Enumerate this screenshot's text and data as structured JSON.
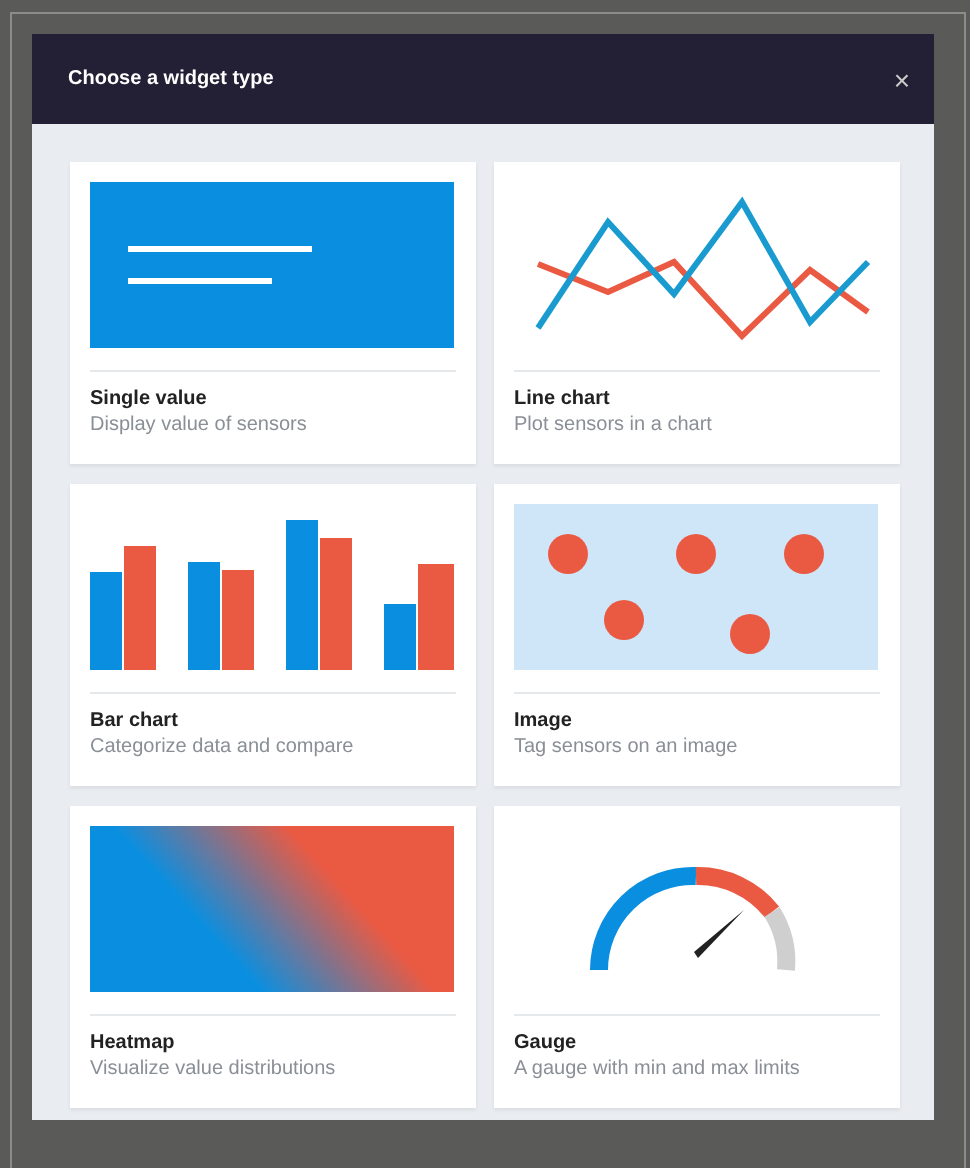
{
  "dialog": {
    "title": "Choose a widget type",
    "close": "×"
  },
  "widgets": [
    {
      "kind": "single_value",
      "title": "Single value",
      "description": "Display value of sensors"
    },
    {
      "kind": "line",
      "title": "Line chart",
      "description": "Plot sensors in a chart"
    },
    {
      "kind": "bar",
      "title": "Bar chart",
      "description": "Categorize data and compare"
    },
    {
      "title": "Image",
      "description": "Tag sensors on an image"
    },
    {
      "kind": "heatmap",
      "title": "Heatmap",
      "description": "Visualize value distributions"
    },
    {
      "kind": "gauge",
      "title": "Gauge",
      "description": "A gauge with min and max limits"
    }
  ]
}
